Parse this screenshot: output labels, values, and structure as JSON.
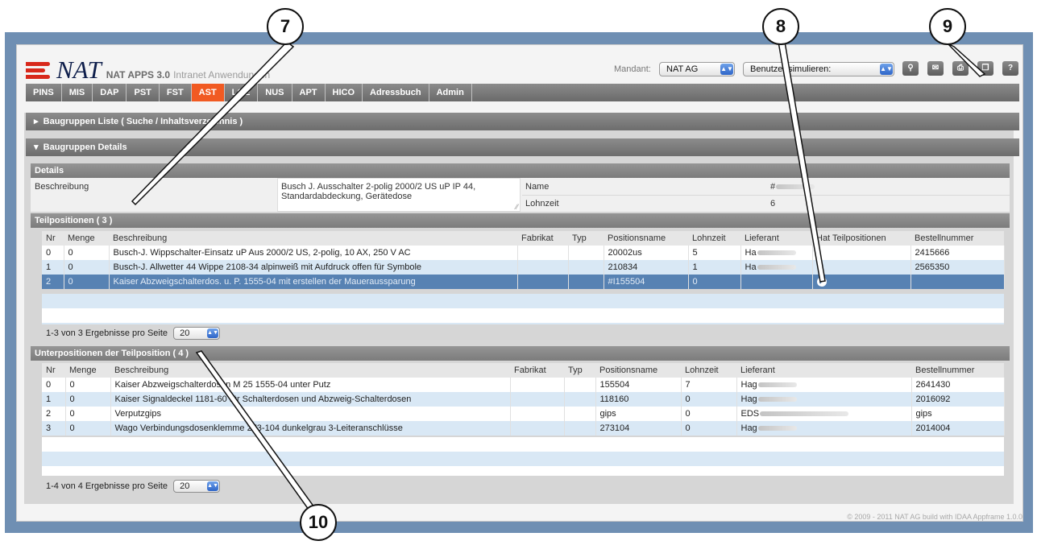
{
  "app": {
    "brand": "NAT",
    "title_bold": "NAT APPS 3.0",
    "title_sub": "Intranet Anwendungen",
    "mandant_label": "Mandant:",
    "mandant_value": "NAT AG",
    "benutzer_value": "Benutzer simulieren:",
    "icons": [
      "pin-icon",
      "chat-icon",
      "print-icon",
      "window-icon",
      "help-icon"
    ],
    "help_label": "?"
  },
  "nav": {
    "tabs": [
      "PINS",
      "MIS",
      "DAP",
      "PST",
      "FST",
      "AST",
      "LGE",
      "NUS",
      "APT",
      "HICO",
      "Adressbuch",
      "Admin"
    ],
    "active": "AST"
  },
  "panels": {
    "liste": "Baugruppen Liste ( Suche / Inhaltsverzeichnis )",
    "details": "Baugruppen Details"
  },
  "details": {
    "header": "Details",
    "beschreibung_label": "Beschreibung",
    "beschreibung_value_line1": "Busch J. Ausschalter 2-polig 2000/2 US uP IP 44,",
    "beschreibung_value_line2": "Standardabdeckung, Gerätedose",
    "name_label": "Name",
    "name_value": "#",
    "lohnzeit_label": "Lohnzeit",
    "lohnzeit_value": "6"
  },
  "teilpositionen": {
    "header": "Teilpositionen ( 3 )",
    "columns": [
      "Nr",
      "Menge",
      "Beschreibung",
      "Fabrikat",
      "Typ",
      "Positionsname",
      "Lohnzeit",
      "Lieferant",
      "Hat Teilpositionen",
      "Bestellnummer"
    ],
    "rows": [
      {
        "nr": "0",
        "menge": "0",
        "beschreibung": "Busch-J. Wippschalter-Einsatz uP Aus 2000/2 US, 2-polig, 10 AX, 250 V AC",
        "fabrikat": "",
        "typ": "",
        "positionsname": "20002us",
        "lohnzeit": "5",
        "lieferant": "Ha",
        "hat": "",
        "bestellnummer": "2415666"
      },
      {
        "nr": "1",
        "menge": "0",
        "beschreibung": "Busch-J. Allwetter 44 Wippe 2108-34 alpinweiß mit Aufdruck offen für Symbole",
        "fabrikat": "",
        "typ": "",
        "positionsname": "210834",
        "lohnzeit": "1",
        "lieferant": "Ha",
        "hat": "",
        "bestellnummer": "2565350"
      },
      {
        "nr": "2",
        "menge": "0",
        "beschreibung": "Kaiser Abzweigschalterdos. u. P. 1555-04 mit erstellen der Maueraussparung",
        "fabrikat": "",
        "typ": "",
        "positionsname": "#I155504",
        "lohnzeit": "0",
        "lieferant": "",
        "hat": "check",
        "bestellnummer": ""
      }
    ],
    "pager_text": "1-3 von 3  Ergebnisse pro Seite",
    "pager_value": "20"
  },
  "unterpositionen": {
    "header": "Unterpositionen der Teilposition ( 4 )",
    "columns": [
      "Nr",
      "Menge",
      "Beschreibung",
      "Fabrikat",
      "Typ",
      "Positionsname",
      "Lohnzeit",
      "Lieferant",
      "Bestellnummer"
    ],
    "rows": [
      {
        "nr": "0",
        "menge": "0",
        "beschreibung": "Kaiser Abzweigschalterdosen M 25 1555-04 unter Putz",
        "fabrikat": "",
        "typ": "",
        "positionsname": "155504",
        "lohnzeit": "7",
        "lieferant": "Hag",
        "bestellnummer": "2641430"
      },
      {
        "nr": "1",
        "menge": "0",
        "beschreibung": "Kaiser Signaldeckel 1181-60 für Schalterdosen und Abzweig-Schalterdosen",
        "fabrikat": "",
        "typ": "",
        "positionsname": "118160",
        "lohnzeit": "0",
        "lieferant": "Hag",
        "bestellnummer": "2016092"
      },
      {
        "nr": "2",
        "menge": "0",
        "beschreibung": "Verputzgips",
        "fabrikat": "",
        "typ": "",
        "positionsname": "gips",
        "lohnzeit": "0",
        "lieferant": "EDS",
        "bestellnummer": "gips"
      },
      {
        "nr": "3",
        "menge": "0",
        "beschreibung": "Wago Verbindungsdosenklemme 273-104 dunkelgrau 3-Leiteranschlüsse",
        "fabrikat": "",
        "typ": "",
        "positionsname": "273104",
        "lohnzeit": "0",
        "lieferant": "Hag",
        "bestellnummer": "2014004"
      }
    ],
    "pager_text": "1-4 von 4  Ergebnisse pro Seite",
    "pager_value": "20"
  },
  "footer": "© 2009 - 2011 NAT AG build with IDAA Appframe 1.0.0",
  "callouts": [
    "7",
    "8",
    "9",
    "10"
  ]
}
